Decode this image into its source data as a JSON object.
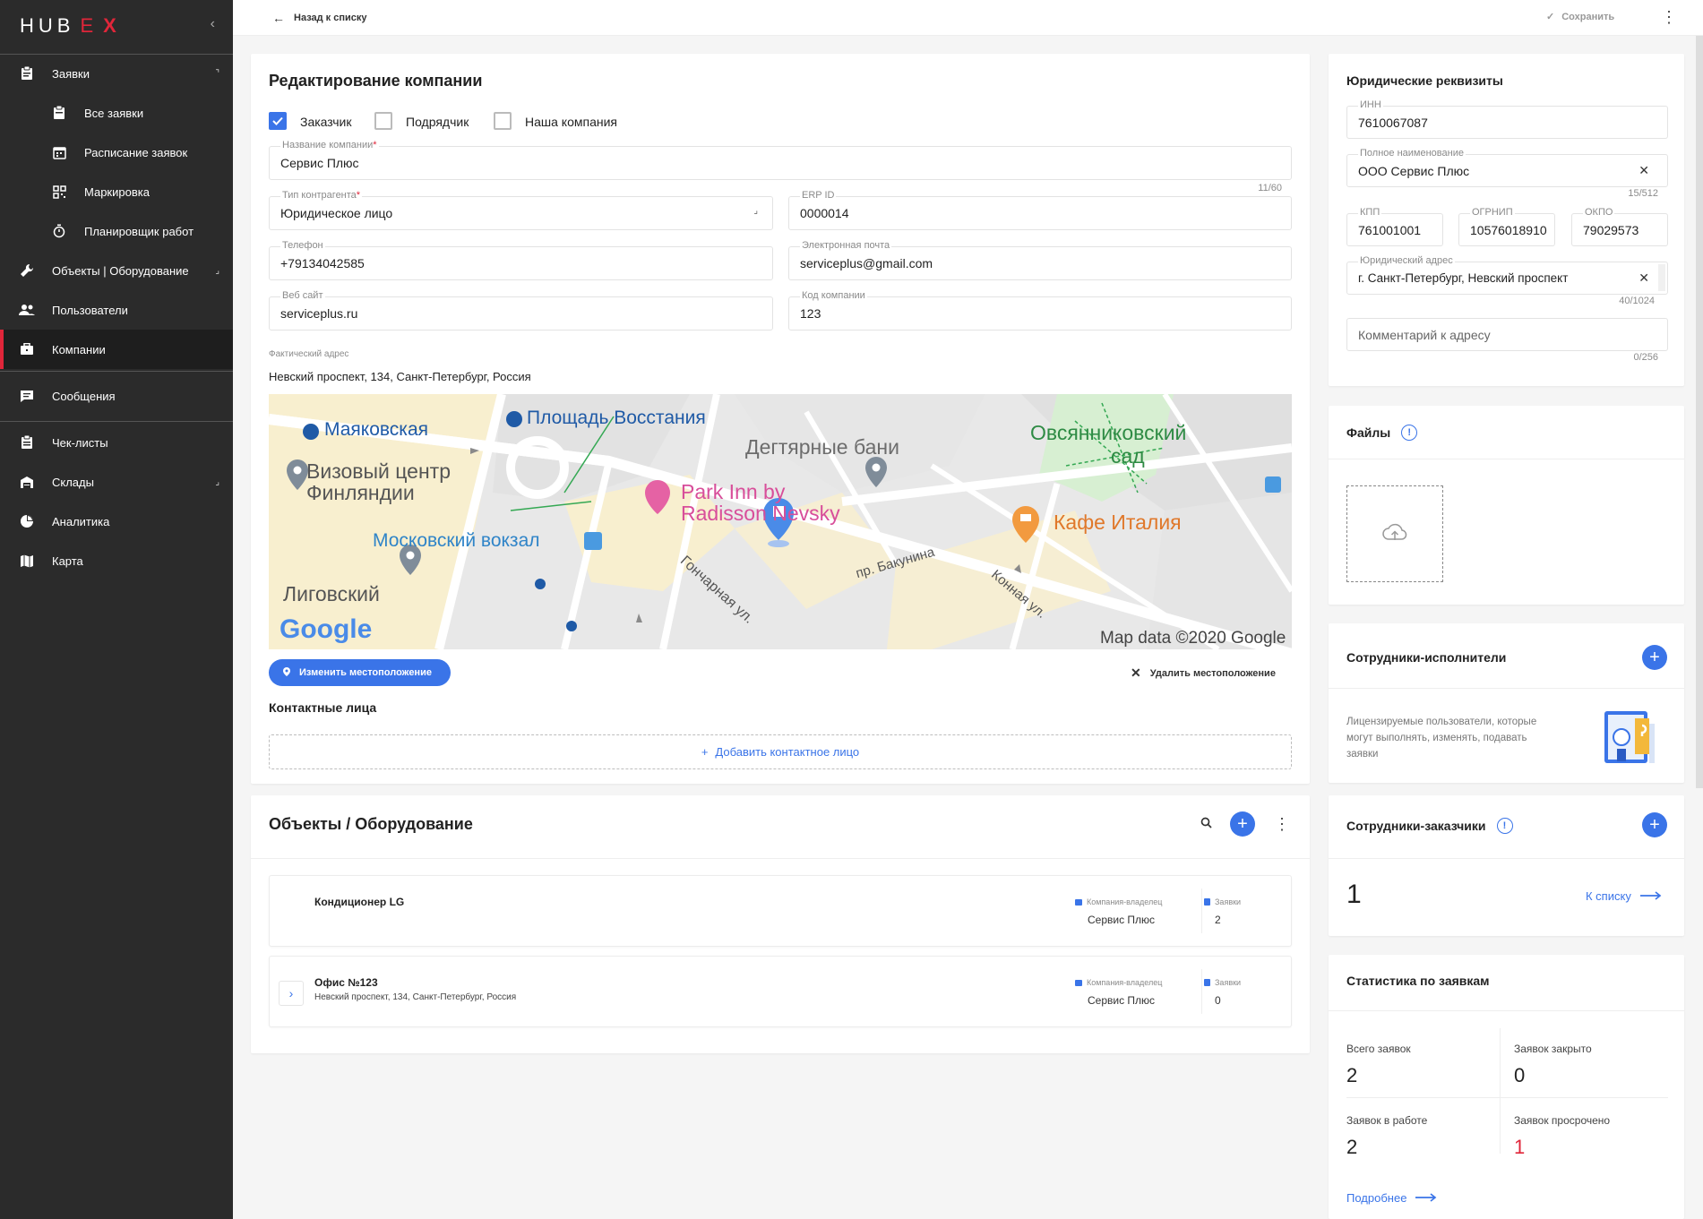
{
  "sidebar": {
    "logo_left": "HUB",
    "logo_x": "X",
    "logo_e": "E",
    "items": [
      {
        "label": "Заявки"
      },
      {
        "label": "Все заявки"
      },
      {
        "label": "Расписание заявок"
      },
      {
        "label": "Маркировка"
      },
      {
        "label": "Планировщик работ"
      },
      {
        "label": "Объекты | Оборудование"
      },
      {
        "label": "Пользователи"
      },
      {
        "label": "Компании"
      },
      {
        "label": "Сообщения"
      },
      {
        "label": "Чек-листы"
      },
      {
        "label": "Склады"
      },
      {
        "label": "Аналитика"
      },
      {
        "label": "Карта"
      }
    ]
  },
  "topbar": {
    "back_label": "Назад к списку",
    "save_label": "Сохранить"
  },
  "company_form": {
    "title": "Редактирование компании",
    "checkboxes": [
      {
        "label": "Заказчик",
        "checked": true
      },
      {
        "label": "Подрядчик",
        "checked": false
      },
      {
        "label": "Наша компания",
        "checked": false
      }
    ],
    "name_label": "Название компании",
    "name_value": "Сервис Плюс",
    "name_counter": "11/60",
    "type_label": "Тип контрагента",
    "type_value": "Юридическое лицо",
    "erp_label": "ERP ID",
    "erp_value": "0000014",
    "phone_label": "Телефон",
    "phone_value": "+79134042585",
    "email_label": "Электронная почта",
    "email_value": "serviceplus@gmail.com",
    "site_label": "Веб сайт",
    "site_value": "serviceplus.ru",
    "code_label": "Код компании",
    "code_value": "123",
    "address_label": "Фактический адрес",
    "address_value": "Невский проспект, 134, Санкт-Петербург, Россия",
    "change_location": "Изменить местоположение",
    "delete_location": "Удалить местоположение",
    "contacts_title": "Контактные лица",
    "add_contact": "Добавить контактное лицо"
  },
  "map": {
    "labels": {
      "mayak": "Маяковская",
      "vosst": "Площадь Восстания",
      "degt": "Дегтярные бани",
      "ovs1": "Овсянниковский",
      "ovs2": "сад",
      "viz1": "Визовый центр",
      "viz2": "Финляндии",
      "park1": "Park Inn by",
      "park2": "Radisson Nevsky",
      "kafe": "Кафе Италия",
      "mosk": "Московский вокзал",
      "ligov": "Лиговский",
      "bak": "пр. Бакунина",
      "gonch": "Гончарная ул.",
      "konn": "Конная ул.",
      "copy": "Map data ©2020 Google",
      "google": "Google"
    }
  },
  "objects": {
    "title": "Объекты / Оборудование",
    "owner_label": "Компания-владелец",
    "requests_label": "Заявки",
    "rows": [
      {
        "name": "Кондиционер LG",
        "address": "",
        "owner": "Сервис Плюс",
        "requests": "2"
      },
      {
        "name": "Офис №123",
        "address": "Невский проспект, 134, Санкт-Петербург, Россия",
        "owner": "Сервис Плюс",
        "requests": "0"
      }
    ]
  },
  "legal": {
    "title": "Юридические реквизиты",
    "inn_label": "ИНН",
    "inn_value": "7610067087",
    "full_label": "Полное наименование",
    "full_value": "ООО Сервис Плюс",
    "full_counter": "15/512",
    "kpp_label": "КПП",
    "kpp_value": "761001001",
    "ogrnip_label": "ОГРНИП",
    "ogrnip_value": "10576018910",
    "okpo_label": "ОКПО",
    "okpo_value": "79029573",
    "legal_addr_label": "Юридический адрес",
    "legal_addr_value": "г. Санкт-Петербург, Невский проспект",
    "legal_addr_counter": "40/1024",
    "comment_placeholder": "Комментарий к адресу",
    "comment_counter": "0/256"
  },
  "files": {
    "title": "Файлы"
  },
  "executors": {
    "title": "Сотрудники-исполнители",
    "description": "Лицензируемые пользователи, которые могут выполнять, изменять, подавать заявки"
  },
  "customers": {
    "title": "Сотрудники-заказчики",
    "count": "1",
    "to_list": "К списку"
  },
  "stats": {
    "title": "Статистика по заявкам",
    "total_label": "Всего заявок",
    "total_value": "2",
    "closed_label": "Заявок закрыто",
    "closed_value": "0",
    "inwork_label": "Заявок в работе",
    "inwork_value": "2",
    "overdue_label": "Заявок просрочено",
    "overdue_value": "1",
    "more": "Подробнее"
  },
  "colors": {
    "accent": "#3a74e8",
    "brand_red": "#e0263a",
    "sidebar": "#2b2b2b"
  }
}
